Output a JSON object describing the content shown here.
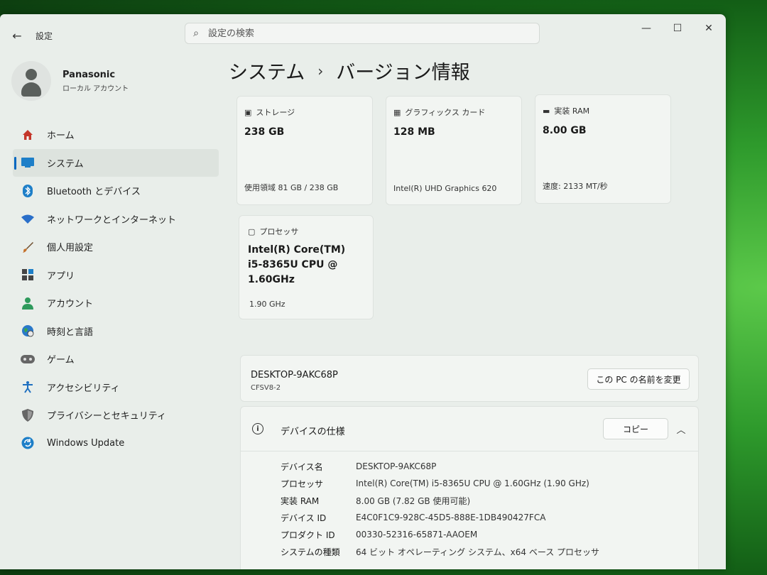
{
  "titlebar": {
    "back": "←",
    "app_title": "設定",
    "search_placeholder": "設定の検索",
    "minimize": "—",
    "maximize": "☐",
    "close": "✕"
  },
  "user": {
    "name": "Panasonic",
    "account_type": "ローカル アカウント"
  },
  "sidebar": {
    "items": [
      {
        "label": "ホーム",
        "icon": "home-icon"
      },
      {
        "label": "システム",
        "icon": "system-icon",
        "active": true
      },
      {
        "label": "Bluetooth とデバイス",
        "icon": "bluetooth-icon"
      },
      {
        "label": "ネットワークとインターネット",
        "icon": "wifi-icon"
      },
      {
        "label": "個人用設定",
        "icon": "brush-icon"
      },
      {
        "label": "アプリ",
        "icon": "apps-icon"
      },
      {
        "label": "アカウント",
        "icon": "account-icon"
      },
      {
        "label": "時刻と言語",
        "icon": "globe-icon"
      },
      {
        "label": "ゲーム",
        "icon": "gamepad-icon"
      },
      {
        "label": "アクセシビリティ",
        "icon": "accessibility-icon"
      },
      {
        "label": "プライバシーとセキュリティ",
        "icon": "shield-icon"
      },
      {
        "label": "Windows Update",
        "icon": "update-icon"
      }
    ]
  },
  "page": {
    "breadcrumb_parent": "システム",
    "breadcrumb_sep": "›",
    "breadcrumb_current": "バージョン情報"
  },
  "cards": {
    "storage": {
      "label": "ストレージ",
      "value": "238 GB",
      "sub": "使用領域 81 GB / 238 GB"
    },
    "graphics": {
      "label": "グラフィックス カード",
      "value": "128 MB",
      "sub": "Intel(R) UHD Graphics 620"
    },
    "ram": {
      "label": "実装 RAM",
      "value": "8.00 GB",
      "sub": "速度: 2133 MT/秒"
    },
    "processor": {
      "label": "プロセッサ",
      "value_line1": "Intel(R) Core(TM)",
      "value_line2": "i5-8365U CPU @",
      "value_line3": "1.60GHz",
      "sub": "1.90 GHz"
    }
  },
  "pc": {
    "name": "DESKTOP-9AKC68P",
    "model": "CFSV8-2",
    "rename_button": "この PC の名前を変更"
  },
  "spec": {
    "title": "デバイスの仕様",
    "copy_button": "コピー",
    "rows": [
      {
        "key": "デバイス名",
        "value": "DESKTOP-9AKC68P"
      },
      {
        "key": "プロセッサ",
        "value": "Intel(R) Core(TM) i5-8365U CPU @ 1.60GHz (1.90 GHz)"
      },
      {
        "key": "実装 RAM",
        "value": "8.00 GB (7.82 GB 使用可能)"
      },
      {
        "key": "デバイス ID",
        "value": "E4C0F1C9-928C-45D5-888E-1DB490427FCA"
      },
      {
        "key": "プロダクト ID",
        "value": "00330-52316-65871-AAOEM"
      },
      {
        "key": "システムの種類",
        "value": "64 ビット オペレーティング システム、x64 ベース プロセッサ"
      }
    ]
  },
  "colors": {
    "accent": "#0067c0",
    "window_bg": "#e9eeea",
    "card_bg": "#f2f5f2"
  }
}
